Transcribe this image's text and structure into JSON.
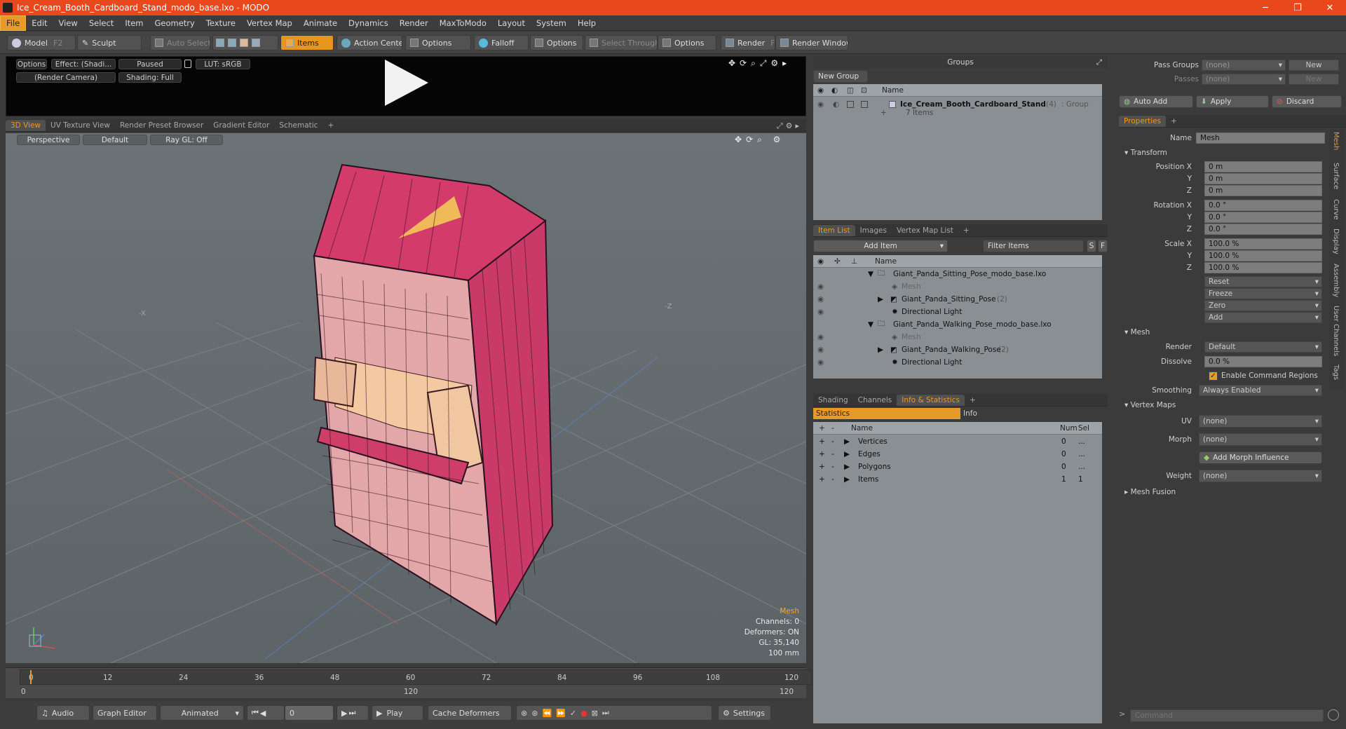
{
  "window": {
    "title": "Ice_Cream_Booth_Cardboard_Stand_modo_base.lxo - MODO"
  },
  "menu": [
    "File",
    "Edit",
    "View",
    "Select",
    "Item",
    "Geometry",
    "Texture",
    "Vertex Map",
    "Animate",
    "Dynamics",
    "Render",
    "MaxToModo",
    "Layout",
    "System",
    "Help"
  ],
  "toolbar": {
    "model": "Model",
    "model_key": "F2",
    "sculpt": "Sculpt",
    "auto_select": "Auto Select",
    "items": "Items",
    "action_center": "Action Center",
    "options1": "Options",
    "falloff": "Falloff",
    "options2": "Options",
    "select_through": "Select Through",
    "options3": "Options",
    "render": "Render",
    "render_key": "F9",
    "render_window": "Render Window"
  },
  "preview": {
    "options": "Options",
    "effect": "Effect: (Shadi...",
    "paused": "Paused",
    "lut": "LUT: sRGB",
    "camera": "(Render Camera)",
    "shading": "Shading: Full"
  },
  "view_tabs": [
    "3D View",
    "UV Texture View",
    "Render Preset Browser",
    "Gradient Editor",
    "Schematic",
    "+"
  ],
  "viewport": {
    "perspective": "Perspective",
    "default": "Default",
    "raygl": "Ray GL: Off",
    "axis_neg_x": "-X",
    "axis_neg_z": "-Z",
    "info": {
      "mesh": "Mesh",
      "channels": "Channels: 0",
      "deformers": "Deformers: ON",
      "gl": "GL: 35,140",
      "unit": "100 mm"
    }
  },
  "timeline": {
    "ticks": [
      "0",
      "12",
      "24",
      "36",
      "48",
      "60",
      "72",
      "84",
      "96",
      "108",
      "120"
    ],
    "start": "0",
    "mid": "120",
    "end": "120"
  },
  "bottom": {
    "audio": "Audio",
    "graph_editor": "Graph Editor",
    "animated": "Animated",
    "frame": "0",
    "play": "Play",
    "cache": "Cache Deformers",
    "settings": "Settings"
  },
  "groups": {
    "title": "Groups",
    "new_group": "New Group",
    "col_name": "Name",
    "item_name": "Ice_Cream_Booth_Cardboard_Stand",
    "item_count": "(4)",
    "item_type": ": Group",
    "item_sub": "7 Items"
  },
  "item_list": {
    "tabs": [
      "Item List",
      "Images",
      "Vertex Map List",
      "+"
    ],
    "add_item": "Add Item",
    "filter": "Filter Items",
    "s": "S",
    "f": "F",
    "col_name": "Name",
    "rows": [
      {
        "label": "Giant_Panda_Sitting_Pose_modo_base.lxo"
      },
      {
        "label": "Mesh"
      },
      {
        "label": "Giant_Panda_Sitting_Pose",
        "count": "(2)"
      },
      {
        "label": "Directional Light"
      },
      {
        "label": "Giant_Panda_Walking_Pose_modo_base.lxo"
      },
      {
        "label": "Mesh"
      },
      {
        "label": "Giant_Panda_Walking_Pose",
        "count": "(2)"
      },
      {
        "label": "Directional Light"
      }
    ]
  },
  "stats": {
    "tabs": [
      "Shading",
      "Channels",
      "Info & Statistics",
      "+"
    ],
    "sub_statistics": "Statistics",
    "sub_info": "Info",
    "cols": {
      "name": "Name",
      "num": "Num",
      "sel": "Sel"
    },
    "rows": [
      {
        "name": "Vertices",
        "num": "0",
        "sel": "..."
      },
      {
        "name": "Edges",
        "num": "0",
        "sel": "..."
      },
      {
        "name": "Polygons",
        "num": "0",
        "sel": "..."
      },
      {
        "name": "Items",
        "num": "1",
        "sel": "1"
      }
    ]
  },
  "pass": {
    "pass_groups": "Pass Groups",
    "passes": "Passes",
    "none1": "(none)",
    "none2": "(none)",
    "new1": "New",
    "new2": "New",
    "auto_add": "Auto Add",
    "apply": "Apply",
    "discard": "Discard"
  },
  "properties": {
    "tab": "Properties",
    "plus": "+",
    "name_label": "Name",
    "name_value": "Mesh",
    "transform": "Transform",
    "pos_label": "Position X",
    "rot_label": "Rotation X",
    "scale_label": "Scale X",
    "y": "Y",
    "z": "Z",
    "pos": [
      "0 m",
      "0 m",
      "0 m"
    ],
    "rot": [
      "0.0 °",
      "0.0 °",
      "0.0 °"
    ],
    "scale": [
      "100.0 %",
      "100.0 %",
      "100.0 %"
    ],
    "reset": "Reset",
    "freeze": "Freeze",
    "zero": "Zero",
    "add": "Add",
    "mesh_section": "Mesh",
    "render_label": "Render",
    "render_value": "Default",
    "dissolve_label": "Dissolve",
    "dissolve_value": "0.0 %",
    "enable_regions": "Enable Command Regions",
    "smoothing_label": "Smoothing",
    "smoothing_value": "Always Enabled",
    "vertex_maps": "Vertex Maps",
    "uv_label": "UV",
    "uv_value": "(none)",
    "morph_label": "Morph",
    "morph_value": "(none)",
    "add_morph": "Add Morph Influence",
    "weight_label": "Weight",
    "weight_value": "(none)",
    "mesh_fusion": "Mesh Fusion",
    "side_tabs": [
      "Mesh",
      "Surface",
      "Curve",
      "Display",
      "Assembly",
      "User Channels",
      "Tags"
    ],
    "command_placeholder": "Command"
  },
  "colors": {
    "accent": "#e69a2a",
    "titlebar": "#e8481c"
  }
}
